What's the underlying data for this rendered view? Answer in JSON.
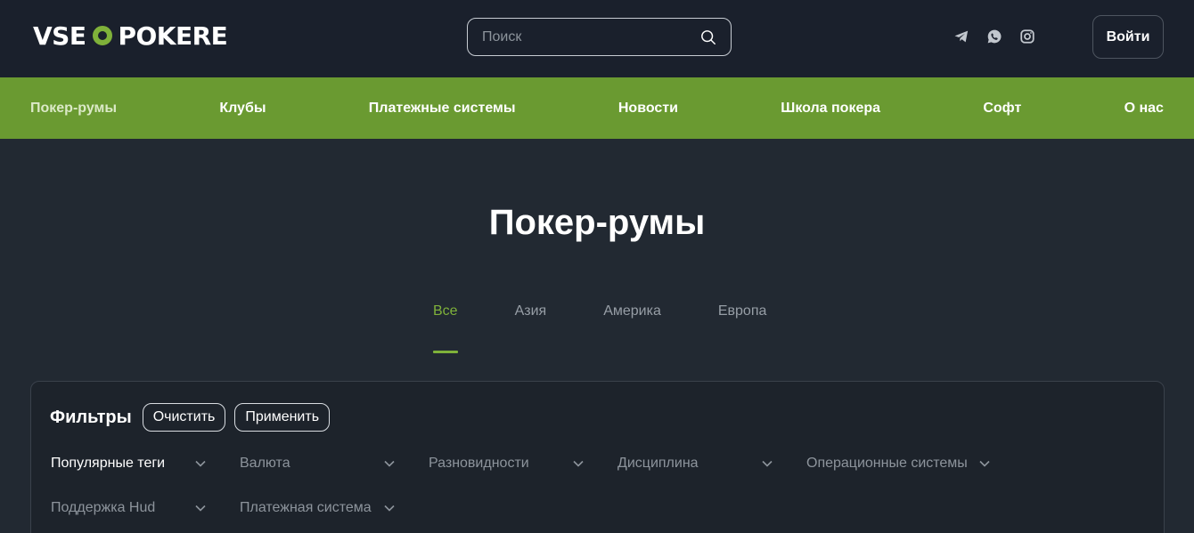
{
  "header": {
    "logo_left": "VSE",
    "logo_right": "POKERE",
    "search_placeholder": "Поиск",
    "login_label": "Войти",
    "socials": [
      "telegram-icon",
      "whatsapp-icon",
      "instagram-icon"
    ]
  },
  "nav": {
    "items": [
      {
        "label": "Покер-румы",
        "active": true
      },
      {
        "label": "Клубы"
      },
      {
        "label": "Платежные системы"
      },
      {
        "label": "Новости"
      },
      {
        "label": "Школа покера"
      },
      {
        "label": "Софт"
      },
      {
        "label": "О нас"
      }
    ]
  },
  "main": {
    "title": "Покер-румы",
    "tabs": [
      {
        "label": "Все",
        "active": true
      },
      {
        "label": "Азия"
      },
      {
        "label": "Америка"
      },
      {
        "label": "Европа"
      }
    ]
  },
  "filters": {
    "title": "Фильтры",
    "clear_label": "Очистить",
    "apply_label": "Применить",
    "dropdowns": [
      "Популярные теги",
      "Валюта",
      "Разновидности",
      "Дисциплина",
      "Операционные системы",
      "Поддержка Hud",
      "Платежная система"
    ]
  },
  "colors": {
    "accent": "#7fb13a",
    "nav_bg": "#6a9a31",
    "header_bg": "#1a202c",
    "page_bg": "#222932"
  }
}
